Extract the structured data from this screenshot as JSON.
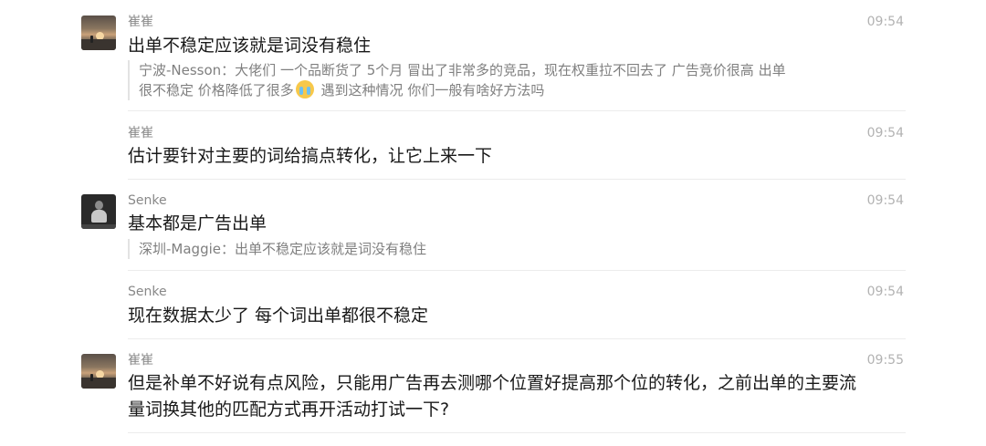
{
  "messages": [
    {
      "sender": "崔崔",
      "time": "09:54",
      "avatar": "sunset-avatar",
      "text_lines": [
        "出单不稳定应该就是词没有稳住"
      ],
      "quote": {
        "line1": "宁波-Nesson：大佬们 一个品断货了 5个月 冒出了非常多的竞品，现在权重拉不回去了 广告竞价很高 出单",
        "line2_before_emoji": "很不稳定 价格降低了很多",
        "emoji": "crying-face-emoji",
        "line2_after_emoji": " 遇到这种情况 你们一般有啥好方法吗"
      }
    },
    {
      "sender": "崔崔",
      "time": "09:54",
      "text_lines": [
        "估计要针对主要的词给搞点转化，让它上来一下"
      ]
    },
    {
      "sender": "Senke",
      "time": "09:54",
      "avatar": "person-avatar",
      "text_lines": [
        "基本都是广告出单"
      ],
      "quote": {
        "line1": "深圳-Maggie：出单不稳定应该就是词没有稳住"
      }
    },
    {
      "sender": "Senke",
      "time": "09:54",
      "text_lines": [
        "现在数据太少了 每个词出单都很不稳定"
      ]
    },
    {
      "sender": "崔崔",
      "time": "09:55",
      "avatar": "sunset-avatar",
      "text_lines": [
        "但是补单不好说有点风险，只能用广告再去测哪个位置好提高那个位的转化，之前出单的主要流",
        "量词换其他的匹配方式再开活动打试一下?"
      ]
    }
  ]
}
